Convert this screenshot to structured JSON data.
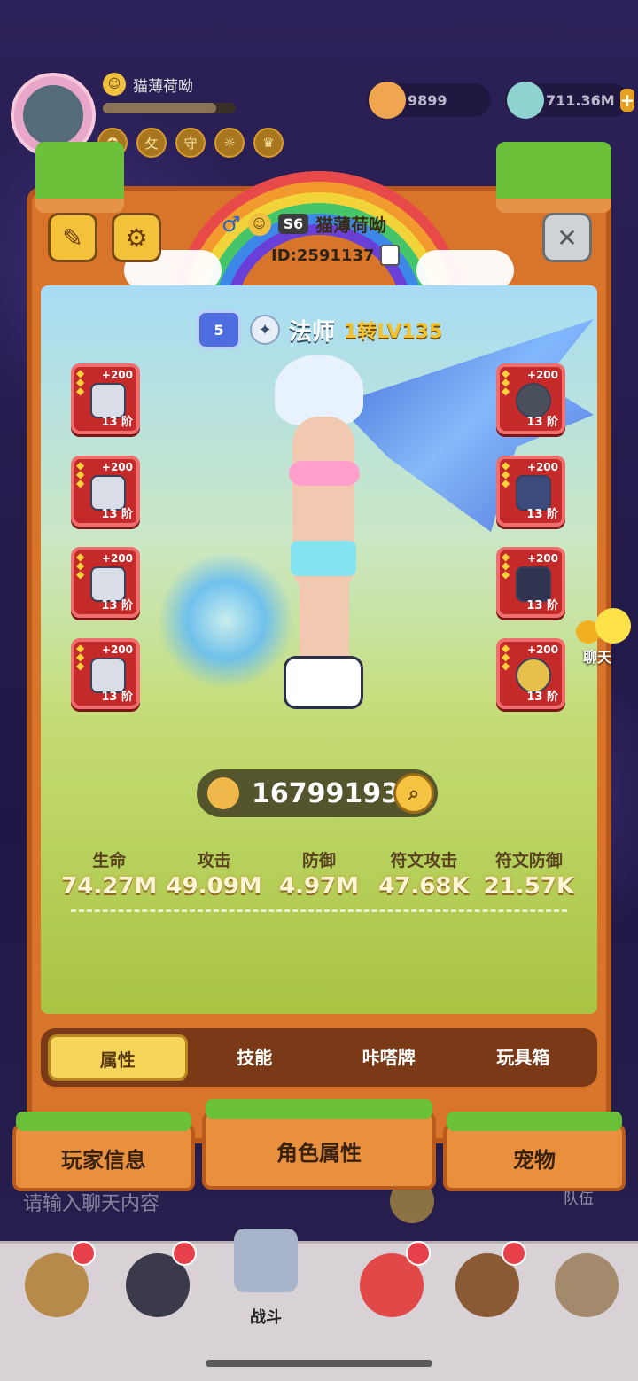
{
  "hud": {
    "player_name": "猫薄荷呦",
    "resource1_value": "9899",
    "resource2_value": "711.36M",
    "plus_label": "+",
    "badges": [
      "✪",
      "攵",
      "守",
      "☼",
      "♛"
    ]
  },
  "profile": {
    "gender_symbol": "♂",
    "season": "S6",
    "name": "猫薄荷呦",
    "id": "ID:2591137",
    "class_name": "法师",
    "class_level": "1转LV135",
    "rank_badge": "5",
    "notes_icon": "✎",
    "settings_icon": "⚙",
    "close_icon": "✕"
  },
  "equipment": {
    "left": [
      {
        "plus": "+200",
        "tier": "13 阶"
      },
      {
        "plus": "+200",
        "tier": "13 阶"
      },
      {
        "plus": "+200",
        "tier": "13 阶"
      },
      {
        "plus": "+200",
        "tier": "13 阶"
      }
    ],
    "right": [
      {
        "plus": "+200",
        "tier": "13 阶"
      },
      {
        "plus": "+200",
        "tier": "13 阶"
      },
      {
        "plus": "+200",
        "tier": "13 阶"
      },
      {
        "plus": "+200",
        "tier": "13 阶"
      }
    ]
  },
  "power": {
    "value": "167991934",
    "search_icon": "⌕"
  },
  "stats": [
    {
      "label": "生命",
      "value": "74.27M"
    },
    {
      "label": "攻击",
      "value": "49.09M"
    },
    {
      "label": "防御",
      "value": "4.97M"
    },
    {
      "label": "符文攻击",
      "value": "47.68K"
    },
    {
      "label": "符文防御",
      "value": "21.57K"
    }
  ],
  "tabs": [
    "属性",
    "技能",
    "咔嗒牌",
    "玩具箱"
  ],
  "bottom_tabs": {
    "left": "玩家信息",
    "center": "角色属性",
    "right": "宠物"
  },
  "chat": {
    "placeholder": "请输入聊天内容",
    "team": "队伍",
    "side_label": "聊天"
  },
  "nav": {
    "battle_label": "战斗"
  },
  "colors": {
    "panel": "#d9752a",
    "grass": "#6cc13a",
    "equip_slot": "#c42a2a",
    "active_tab": "#f6d55a",
    "level_gold": "#f5c22b"
  }
}
